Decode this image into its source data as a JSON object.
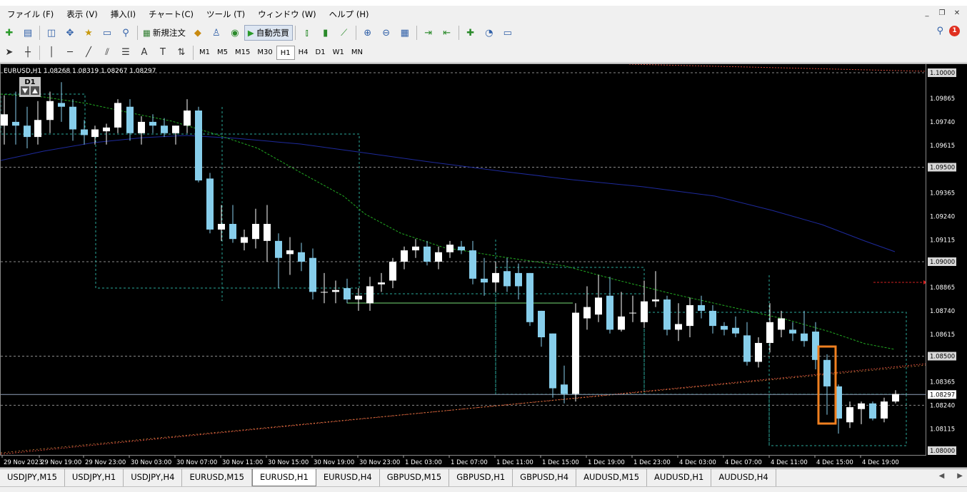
{
  "menu": [
    "ファイル (F)",
    "表示 (V)",
    "挿入(I)",
    "チャート(C)",
    "ツール (T)",
    "ウィンドウ (W)",
    "ヘルプ (H)"
  ],
  "toolbar": {
    "new_order": "新規注文",
    "auto_trade": "自動売買",
    "timeframes": [
      "M1",
      "M5",
      "M15",
      "M30",
      "H1",
      "H4",
      "D1",
      "W1",
      "MN"
    ],
    "active_timeframe": "H1",
    "notification_count": "1",
    "text_tool": "A"
  },
  "chart": {
    "header": "EURUSD,H1  1.08268 1.08319 1.08267 1.08297",
    "period_badge": "D1",
    "current_price": "1.08297",
    "price_labels": [
      "1.10000",
      "1.09865",
      "1.09740",
      "1.09615",
      "1.09500",
      "1.09365",
      "1.09240",
      "1.09115",
      "1.09000",
      "1.08865",
      "1.08740",
      "1.08615",
      "1.08500",
      "1.08365",
      "1.08240",
      "1.08115",
      "1.08000"
    ],
    "time_labels": [
      "29 Nov 2023",
      "29 Nov 19:00",
      "29 Nov 23:00",
      "30 Nov 03:00",
      "30 Nov 07:00",
      "30 Nov 11:00",
      "30 Nov 15:00",
      "30 Nov 19:00",
      "30 Nov 23:00",
      "1 Dec 03:00",
      "1 Dec 07:00",
      "1 Dec 11:00",
      "1 Dec 15:00",
      "1 Dec 19:00",
      "1 Dec 23:00",
      "4 Dec 03:00",
      "4 Dec 07:00",
      "4 Dec 11:00",
      "4 Dec 15:00",
      "4 Dec 19:00"
    ],
    "colors": {
      "bull": "#ffffff",
      "bear": "#87ceeb",
      "highlight": "#f08020",
      "ma_blue": "#1e2a9c",
      "ma_green": "#22aa22"
    }
  },
  "tabs": [
    "USDJPY,M15",
    "USDJPY,H1",
    "USDJPY,H4",
    "EURUSD,M15",
    "EURUSD,H1",
    "EURUSD,H4",
    "GBPUSD,M15",
    "GBPUSD,H1",
    "GBPUSD,H4",
    "AUDUSD,M15",
    "AUDUSD,H1",
    "AUDUSD,H4"
  ],
  "active_tab": "EURUSD,H1"
}
